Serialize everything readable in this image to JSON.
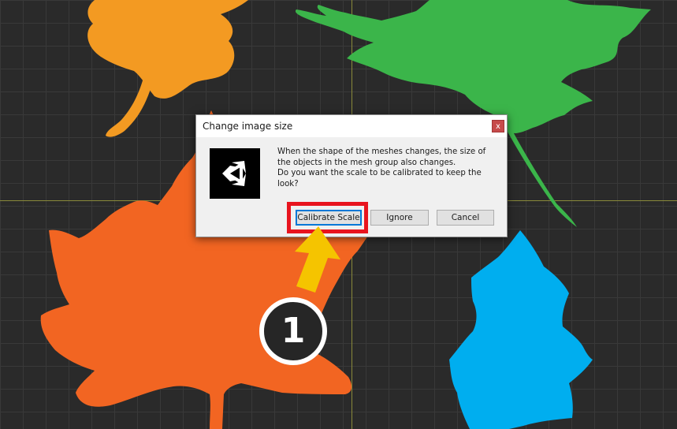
{
  "dialog": {
    "title": "Change image size",
    "close_symbol": "x",
    "icon": "unity-logo-icon",
    "message_lines": [
      "When the shape of the meshes changes, the size of",
      "the objects in the mesh group also changes.",
      "Do you want the scale to be calibrated to keep the",
      "look?"
    ],
    "buttons": {
      "calibrate": "Calibrate Scale",
      "ignore": "Ignore",
      "cancel": "Cancel"
    }
  },
  "annotation": {
    "step_number": "1",
    "highlight_color": "#e8141e",
    "arrow_color": "#f5c400"
  },
  "canvas": {
    "background_color": "#2a2a2a",
    "grid_color": "#393939",
    "axis_color": "#8a8a3a"
  },
  "leaves": [
    {
      "name": "orange-leaf",
      "color": "#f39a22"
    },
    {
      "name": "green-leaf",
      "color": "#3bb54a"
    },
    {
      "name": "red-orange-leaf",
      "color": "#f26522"
    },
    {
      "name": "blue-leaf",
      "color": "#00aeef"
    }
  ]
}
